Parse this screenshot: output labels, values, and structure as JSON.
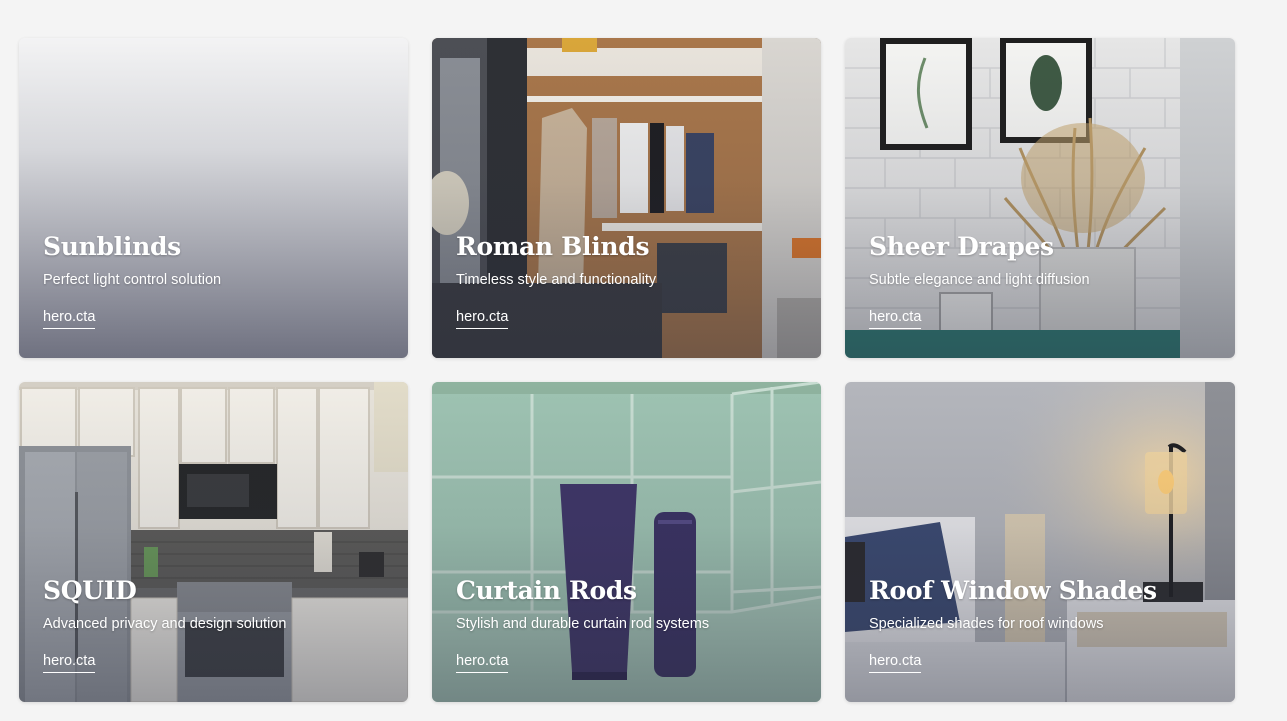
{
  "cards": [
    {
      "title": "Sunblinds",
      "description": "Perfect light control solution",
      "cta": "hero.cta",
      "image": "blank-gradient"
    },
    {
      "title": "Roman Blinds",
      "description": "Timeless style and functionality",
      "cta": "hero.cta",
      "image": "walk-in-closet-photo"
    },
    {
      "title": "Sheer Drapes",
      "description": "Subtle elegance and light diffusion",
      "cta": "hero.cta",
      "image": "brick-wall-dried-grass-photo"
    },
    {
      "title": "SQUID",
      "description": "Advanced privacy and design solution",
      "cta": "hero.cta",
      "image": "kitchen-photo"
    },
    {
      "title": "Curtain Rods",
      "description": "Stylish and durable curtain rod systems",
      "cta": "hero.cta",
      "image": "bathroom-tiles-tubes-photo"
    },
    {
      "title": "Roof Window Shades",
      "description": "Specialized shades for roof windows",
      "cta": "hero.cta",
      "image": "bedroom-lamp-photo"
    }
  ],
  "colors": {
    "page_background": "#f4f4f4",
    "text": "#ffffff"
  }
}
